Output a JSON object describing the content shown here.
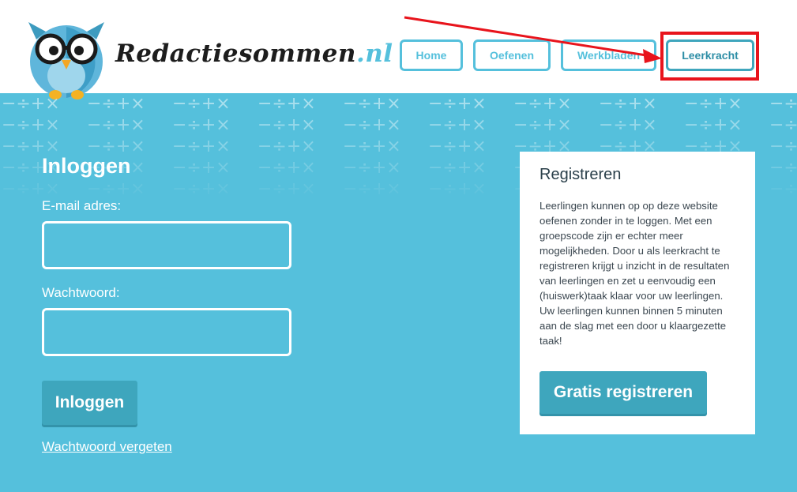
{
  "brand": {
    "logo_name": "Redactiesommen",
    "logo_tld": ".nl"
  },
  "nav": {
    "items": [
      {
        "label": "Home"
      },
      {
        "label": "Oefenen"
      },
      {
        "label": "Werkbladen"
      },
      {
        "label": "Leerkracht"
      }
    ]
  },
  "login": {
    "title": "Inloggen",
    "email_label": "E-mail adres:",
    "email_value": "",
    "password_label": "Wachtwoord:",
    "password_value": "",
    "submit_label": "Inloggen",
    "forgot_label": "Wachtwoord vergeten"
  },
  "register": {
    "title": "Registreren",
    "text": "Leerlingen kunnen op op deze website oefenen zonder in te loggen. Met een groepscode zijn er echter meer mogelijkheden. Door u als leerkracht te registreren krijgt u inzicht in de resultaten van leerlingen en zet u eenvoudig een (huiswerk)taak klaar voor uw leerlingen. Uw leerlingen kunnen binnen 5 minuten aan de slag met een door u klaargezette taak!",
    "button_label": "Gratis registreren"
  },
  "colors": {
    "brand_blue": "#55c0dc",
    "button_blue": "#3ea6bd",
    "annotation_red": "#e8141c"
  },
  "annotations": {
    "highlighted_nav_item": "Leerkracht"
  }
}
